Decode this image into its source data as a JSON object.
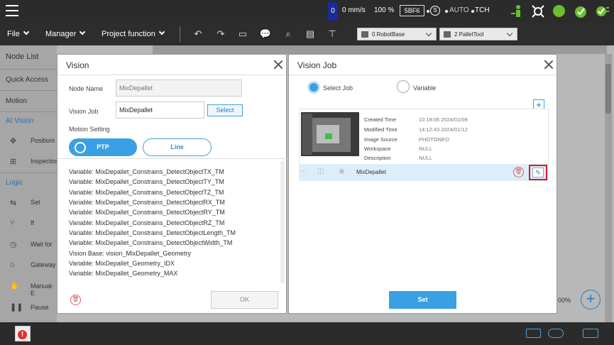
{
  "status": {
    "zero": "0",
    "speed": "0 mm/s",
    "percent": "100 %",
    "code": "5BF6",
    "s_glyph": "S",
    "mode": "AUTO",
    "tch": "TCH"
  },
  "toolbar": {
    "file": "File",
    "manager": "Manager",
    "project_function": "Project function",
    "base_dropdown": "0 RobotBase",
    "tool_dropdown": "2 PalletTool"
  },
  "sidebar": {
    "node_list": "Node List",
    "quick_access": "Quick Access",
    "motion": "Motion",
    "ai_vision": "AI Vision",
    "positioning": "Positioni",
    "inspection": "Inspection",
    "logic": "Logic",
    "set": "Set",
    "if": "If",
    "wait_for": "Wait for",
    "gateway": "Gateway",
    "manual": "Manual-E",
    "pause": "Pause"
  },
  "canvas": {
    "zoom": "00%"
  },
  "vision_dialog": {
    "title": "Vision",
    "node_name_label": "Node Name",
    "node_name_placeholder": "MixDepallet",
    "vision_job_label": "Vision Job",
    "vision_job_value": "MixDepallet",
    "select_button": "Select",
    "motion_setting_label": "Motion Setting",
    "ptp_label": "PTP",
    "line_label": "Line",
    "variables": [
      "Variable: MixDepallet_Constrains_DetectObjectTX_TM",
      "Variable: MixDepallet_Constrains_DetectObjectTY_TM",
      "Variable: MixDepallet_Constrains_DetectObjectTZ_TM",
      "Variable: MixDepallet_Constrains_DetectObjectRX_TM",
      "Variable: MixDepallet_Constrains_DetectObjectRY_TM",
      "Variable: MixDepallet_Constrains_DetectObjectRZ_TM",
      "Variable: MixDepallet_Constrains_DetectObjectLength_TM",
      "Variable: MixDepallet_Constrains_DetectObjectWidth_TM",
      "Vision Base: vision_MixDepallet_Geometry",
      "Variable: MixDepallet_Geometry_IDX",
      "Variable: MixDepallet_Geometry_MAX"
    ],
    "ok_button": "OK"
  },
  "vision_job_dialog": {
    "title": "Vision Job",
    "select_job_label": "Select Job",
    "variable_label": "Variable",
    "meta_labels": [
      "Created Time",
      "Modified Time",
      "Image Source",
      "Workspace",
      "Description"
    ],
    "meta_values": [
      "10:18:05 2024/01/09",
      "14:12:43 2024/01/12",
      "PHOTONEO",
      "NULL",
      "NULL"
    ],
    "job_name": "MixDepallet",
    "set_button": "Set"
  }
}
